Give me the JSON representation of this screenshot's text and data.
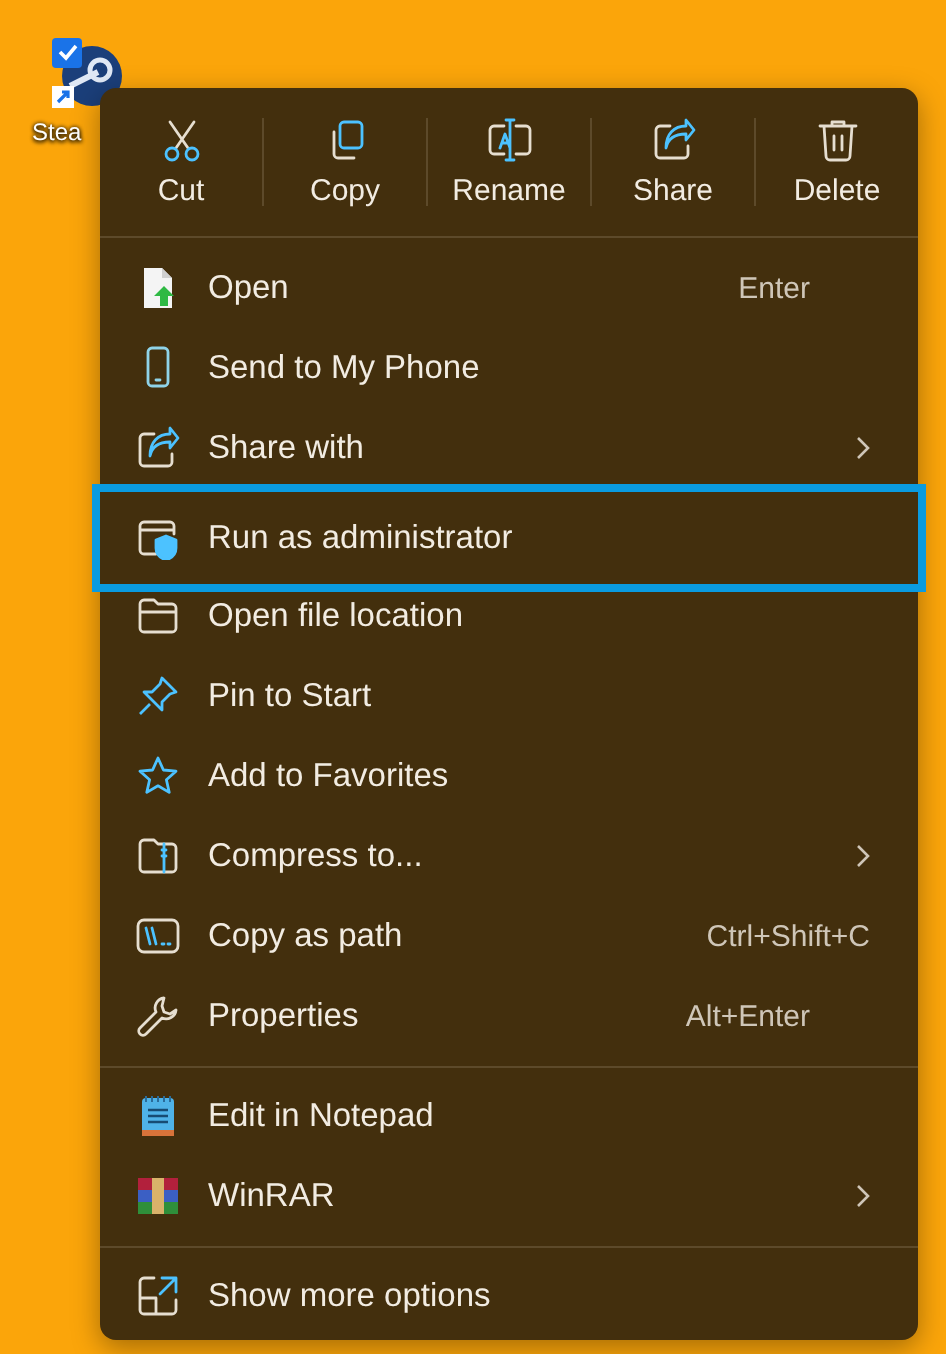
{
  "desktop_icon": {
    "label": "Stea"
  },
  "toolbar": [
    {
      "label": "Cut"
    },
    {
      "label": "Copy"
    },
    {
      "label": "Rename"
    },
    {
      "label": "Share"
    },
    {
      "label": "Delete"
    }
  ],
  "sections": [
    [
      {
        "label": "Open",
        "shortcut": "Enter",
        "submenu": false,
        "selected": false
      },
      {
        "label": "Send to My Phone",
        "submenu": false,
        "selected": false
      },
      {
        "label": "Share with",
        "submenu": true,
        "selected": false
      },
      {
        "label": "Run as administrator",
        "submenu": false,
        "selected": true
      },
      {
        "label": "Open file location",
        "submenu": false,
        "selected": false
      },
      {
        "label": "Pin to Start",
        "submenu": false,
        "selected": false
      },
      {
        "label": "Add to Favorites",
        "submenu": false,
        "selected": false
      },
      {
        "label": "Compress to...",
        "submenu": true,
        "selected": false
      },
      {
        "label": "Copy as path",
        "shortcut": "Ctrl+Shift+C",
        "submenu": false,
        "selected": false
      },
      {
        "label": "Properties",
        "shortcut": "Alt+Enter",
        "submenu": false,
        "selected": false
      }
    ],
    [
      {
        "label": "Edit in Notepad",
        "submenu": false,
        "selected": false
      },
      {
        "label": "WinRAR",
        "submenu": true,
        "selected": false
      }
    ],
    [
      {
        "label": "Show more options",
        "submenu": false,
        "selected": false
      }
    ]
  ]
}
